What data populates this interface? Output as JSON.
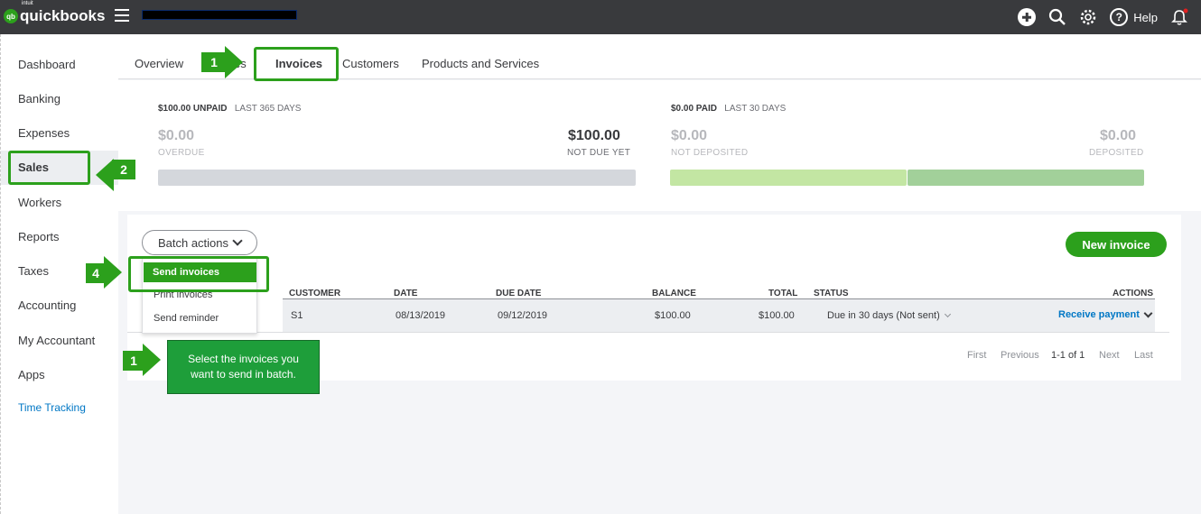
{
  "topbar": {
    "logo_intuit": "intuit",
    "logo_text": "quickbooks",
    "logo_badge": "qb",
    "help_label": "Help",
    "icons": [
      "plus-icon",
      "search-icon",
      "gear-icon",
      "help-icon",
      "bell-icon"
    ]
  },
  "sidebar": {
    "items": [
      {
        "label": "Dashboard"
      },
      {
        "label": "Banking"
      },
      {
        "label": "Expenses"
      },
      {
        "label": "Sales",
        "active": true
      },
      {
        "label": "Workers"
      },
      {
        "label": "Reports"
      },
      {
        "label": "Taxes"
      },
      {
        "label": "Accounting"
      },
      {
        "label": "My Accountant"
      },
      {
        "label": "Apps"
      },
      {
        "label": "Time Tracking",
        "link": true
      }
    ]
  },
  "tabs": {
    "items": [
      {
        "label": "Overview"
      },
      {
        "label": "All Sales",
        "visible_text": "es"
      },
      {
        "label": "Invoices",
        "active": true
      },
      {
        "label": "Customers"
      },
      {
        "label": "Products and Services"
      }
    ]
  },
  "summary": {
    "unpaid": {
      "head_amount": "$100.00 UNPAID",
      "head_period": "LAST 365 DAYS",
      "overdue_amount": "$0.00",
      "overdue_label": "OVERDUE",
      "not_due_amount": "$100.00",
      "not_due_label": "NOT DUE YET"
    },
    "paid": {
      "head_amount": "$0.00 PAID",
      "head_period": "LAST 30 DAYS",
      "not_deposited_amount": "$0.00",
      "not_deposited_label": "NOT DEPOSITED",
      "deposited_amount": "$0.00",
      "deposited_label": "DEPOSITED"
    },
    "colors": {
      "unpaid_bar": "#d4d7dc",
      "not_deposited_bar": "#c3e6a3",
      "deposited_bar": "#a2d09a"
    }
  },
  "toolbar": {
    "batch_actions_label": "Batch actions",
    "new_invoice_label": "New invoice"
  },
  "batch_menu": {
    "items": [
      "Send invoices",
      "Print invoices",
      "Send reminder"
    ]
  },
  "table": {
    "columns": [
      "CUSTOMER",
      "DATE",
      "DUE DATE",
      "BALANCE",
      "TOTAL",
      "STATUS",
      "ACTIONS"
    ],
    "rows": [
      {
        "customer": "S1",
        "date": "08/13/2019",
        "due_date": "09/12/2019",
        "balance": "$100.00",
        "total": "$100.00",
        "status": "Due in 30 days (Not sent)",
        "action": "Receive payment"
      }
    ]
  },
  "pager": {
    "first": "First",
    "previous": "Previous",
    "range": "1-1 of 1",
    "next": "Next",
    "last": "Last"
  },
  "annotations": {
    "step_tabs": "1",
    "step_sales": "2",
    "step_send": "4",
    "step_select": "1",
    "note_line1": "Select the invoices you",
    "note_line2": "want to send in batch.",
    "accent_color": "#2ca01c"
  }
}
